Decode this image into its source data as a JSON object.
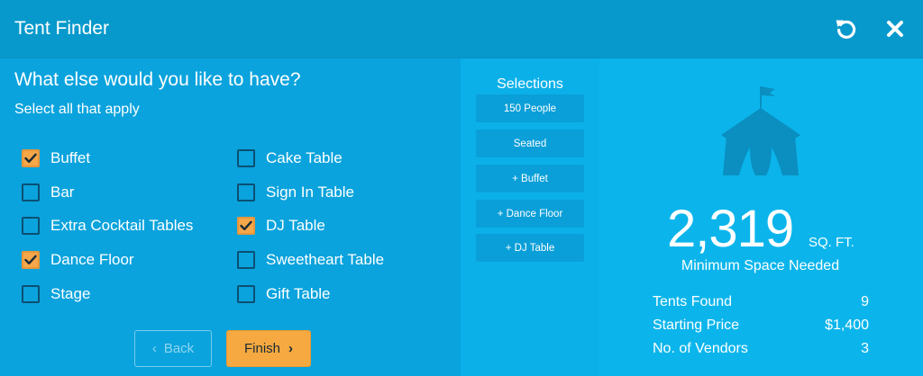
{
  "header": {
    "title": "Tent Finder",
    "reset_icon": "reset-icon",
    "close_icon": "close-icon"
  },
  "question": {
    "title": "What else would you like to have?",
    "subtitle": "Select all that apply"
  },
  "options": {
    "col1": [
      {
        "label": "Buffet",
        "checked": true
      },
      {
        "label": "Bar",
        "checked": false
      },
      {
        "label": "Extra Cocktail Tables",
        "checked": false
      },
      {
        "label": "Dance Floor",
        "checked": true
      },
      {
        "label": "Stage",
        "checked": false
      }
    ],
    "col2": [
      {
        "label": "Cake Table",
        "checked": false
      },
      {
        "label": "Sign In Table",
        "checked": false
      },
      {
        "label": "DJ Table",
        "checked": true
      },
      {
        "label": "Sweetheart Table",
        "checked": false
      },
      {
        "label": "Gift Table",
        "checked": false
      }
    ]
  },
  "buttons": {
    "back": "Back",
    "finish": "Finish"
  },
  "selections": {
    "title": "Selections",
    "items": [
      "150 People",
      "Seated",
      "+ Buffet",
      "+ Dance Floor",
      "+ DJ Table"
    ]
  },
  "summary": {
    "space_value": "2,319",
    "space_unit": "SQ. FT.",
    "space_label": "Minimum Space Needed",
    "icon": "circus-tent-icon",
    "stats": [
      {
        "label": "Tents Found",
        "value": "9"
      },
      {
        "label": "Starting Price",
        "value": "$1,400"
      },
      {
        "label": "No. of Vendors",
        "value": "3"
      }
    ]
  },
  "colors": {
    "header_bg": "#0799cc",
    "left_bg": "#0aa3dd",
    "middle_bg": "#0bb0e9",
    "right_bg": "#0bb5ec",
    "accent_orange": "#f5a940",
    "checkbox_border": "#0b4f73",
    "tent_icon": "#0a8fc0"
  }
}
